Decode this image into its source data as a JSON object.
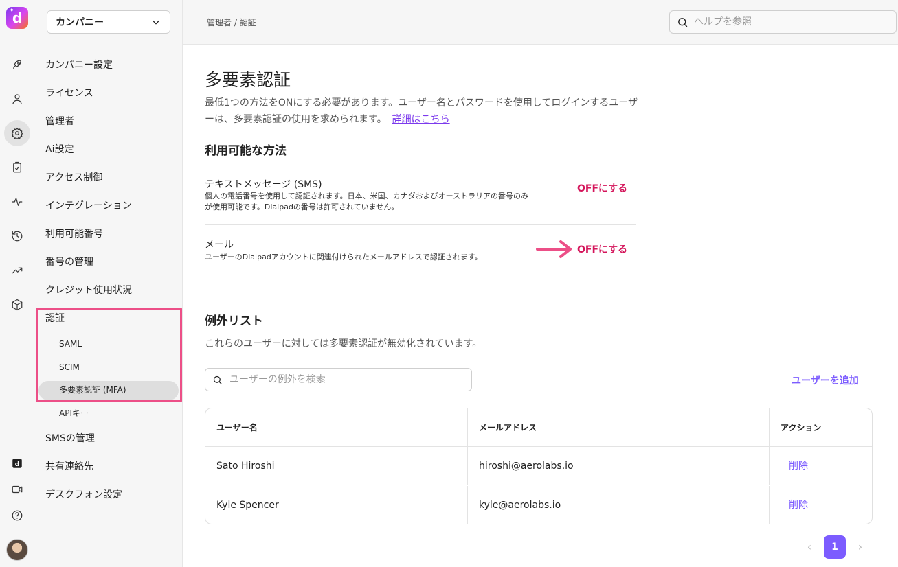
{
  "app": {
    "logo_letter": "d"
  },
  "sidebar": {
    "company": "カンパニー",
    "items": [
      {
        "label": "カンパニー設定"
      },
      {
        "label": "ライセンス"
      },
      {
        "label": "管理者"
      },
      {
        "label": "Ai設定"
      },
      {
        "label": "アクセス制御"
      },
      {
        "label": "インテグレーション"
      },
      {
        "label": "利用可能番号"
      },
      {
        "label": "番号の管理"
      },
      {
        "label": "クレジット使用状況"
      },
      {
        "label": "認証"
      },
      {
        "label": "SMSの管理"
      },
      {
        "label": "共有連絡先"
      },
      {
        "label": "デスクフォン設定"
      }
    ],
    "auth_sub": [
      {
        "label": "SAML"
      },
      {
        "label": "SCIM"
      },
      {
        "label": "多要素認証 (MFA)"
      },
      {
        "label": "APIキー"
      }
    ]
  },
  "header": {
    "breadcrumb": "管理者 / 認証",
    "help_placeholder": "ヘルプを参照"
  },
  "main": {
    "title": "多要素認証",
    "description": "最低1つの方法をONにする必要があります。ユーザー名とパスワードを使用してログインするユーザーは、多要素認証の使用を求められます。",
    "learn_more": "詳細はこちら",
    "methods_title": "利用可能な方法",
    "methods": [
      {
        "title": "テキストメッセージ (SMS)",
        "description": "個人の電話番号を使用して認証されます。日本、米国、カナダおよびオーストラリアの番号のみが使用可能です。Dialpadの番号は許可されていません。",
        "action": "OFFにする"
      },
      {
        "title": "メール",
        "description": "ユーザーのDialpadアカウントに関連付けられたメールアドレスで認証されます。",
        "action": "OFFにする"
      }
    ],
    "exceptions_title": "例外リスト",
    "exceptions_description": "これらのユーザーに対しては多要素認証が無効化されています。",
    "search_placeholder": "ユーザーの例外を検索",
    "add_user": "ユーザーを追加",
    "table": {
      "headers": [
        "ユーザー名",
        "メールアドレス",
        "アクション"
      ],
      "rows": [
        {
          "name": "Sato Hiroshi",
          "email": "hiroshi@aerolabs.io",
          "action": "削除"
        },
        {
          "name": "Kyle Spencer",
          "email": "kyle@aerolabs.io",
          "action": "削除"
        }
      ]
    },
    "pagination": {
      "prev": "‹",
      "page": "1",
      "next": "›"
    }
  },
  "colors": {
    "accent": "#7c5cff",
    "danger": "#d4145a",
    "highlight": "#ec4f87"
  }
}
